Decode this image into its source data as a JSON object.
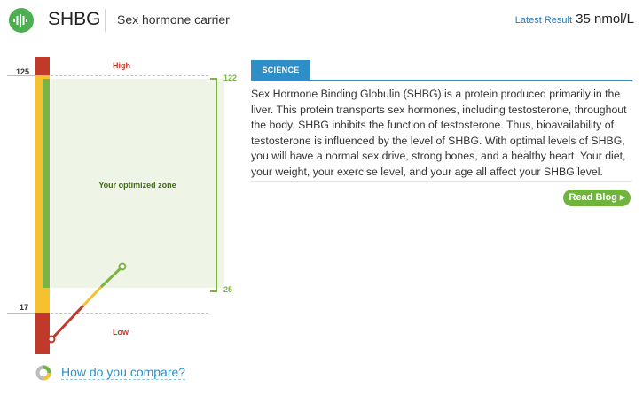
{
  "header": {
    "icon": "dna-bars-icon",
    "title": "SHBG",
    "subtitle": "Sex hormone carrier",
    "latest_label": "Latest Result",
    "latest_value": "35 nmol/L"
  },
  "chart": {
    "axis_top": "125",
    "axis_bottom": "17",
    "high_label": "High",
    "low_label": "Low",
    "zone_label": "Your optimized zone",
    "zone_top": "122",
    "zone_bottom": "25",
    "colors": {
      "red": "#c0392b",
      "yellow": "#f6c12f",
      "green": "#7cb342",
      "zone_bg": "#eef5e6"
    }
  },
  "science": {
    "tab": "SCIENCE",
    "text": "Sex Hormone Binding Globulin (SHBG) is a protein produced primarily in the liver. This protein transports sex hormones, including testosterone, throughout the body. SHBG inhibits the function of testosterone. Thus, bioavailability of testosterone is influenced by the level of SHBG. With optimal levels of SHBG, you will have a normal sex drive, strong bones, and a healthy heart. Your diet, your weight, your exercise level, and your age all affect your SHBG level.",
    "button": "Read Blog ▸"
  },
  "compare": {
    "icon": "donut-chart-icon",
    "link": "How do you compare?"
  }
}
